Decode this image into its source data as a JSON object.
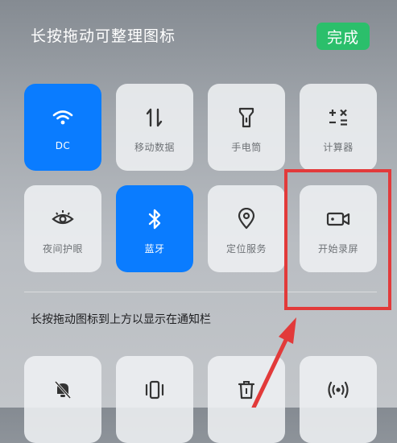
{
  "header": {
    "title": "长按拖动可整理图标",
    "done_label": "完成"
  },
  "tiles": [
    {
      "label": "DC",
      "icon": "wifi-icon",
      "active": true
    },
    {
      "label": "移动数据",
      "icon": "mobile-data-icon",
      "active": false
    },
    {
      "label": "手电筒",
      "icon": "flashlight-icon",
      "active": false
    },
    {
      "label": "计算器",
      "icon": "calculator-icon",
      "active": false
    },
    {
      "label": "夜间护眼",
      "icon": "eye-icon",
      "active": false
    },
    {
      "label": "蓝牙",
      "icon": "bluetooth-icon",
      "active": true
    },
    {
      "label": "定位服务",
      "icon": "location-icon",
      "active": false
    },
    {
      "label": "开始录屏",
      "icon": "screen-record-icon",
      "active": false
    }
  ],
  "section": {
    "label": "长按拖动图标到上方以显示在通知栏"
  },
  "bottom_tiles": [
    {
      "icon": "mute-bell-icon"
    },
    {
      "icon": "vibrate-icon"
    },
    {
      "icon": "trash-icon"
    },
    {
      "icon": "broadcast-icon"
    }
  ],
  "colors": {
    "active_tile": "#0a7cff",
    "done_button": "#2bbf6b",
    "highlight": "#e23a3a"
  }
}
